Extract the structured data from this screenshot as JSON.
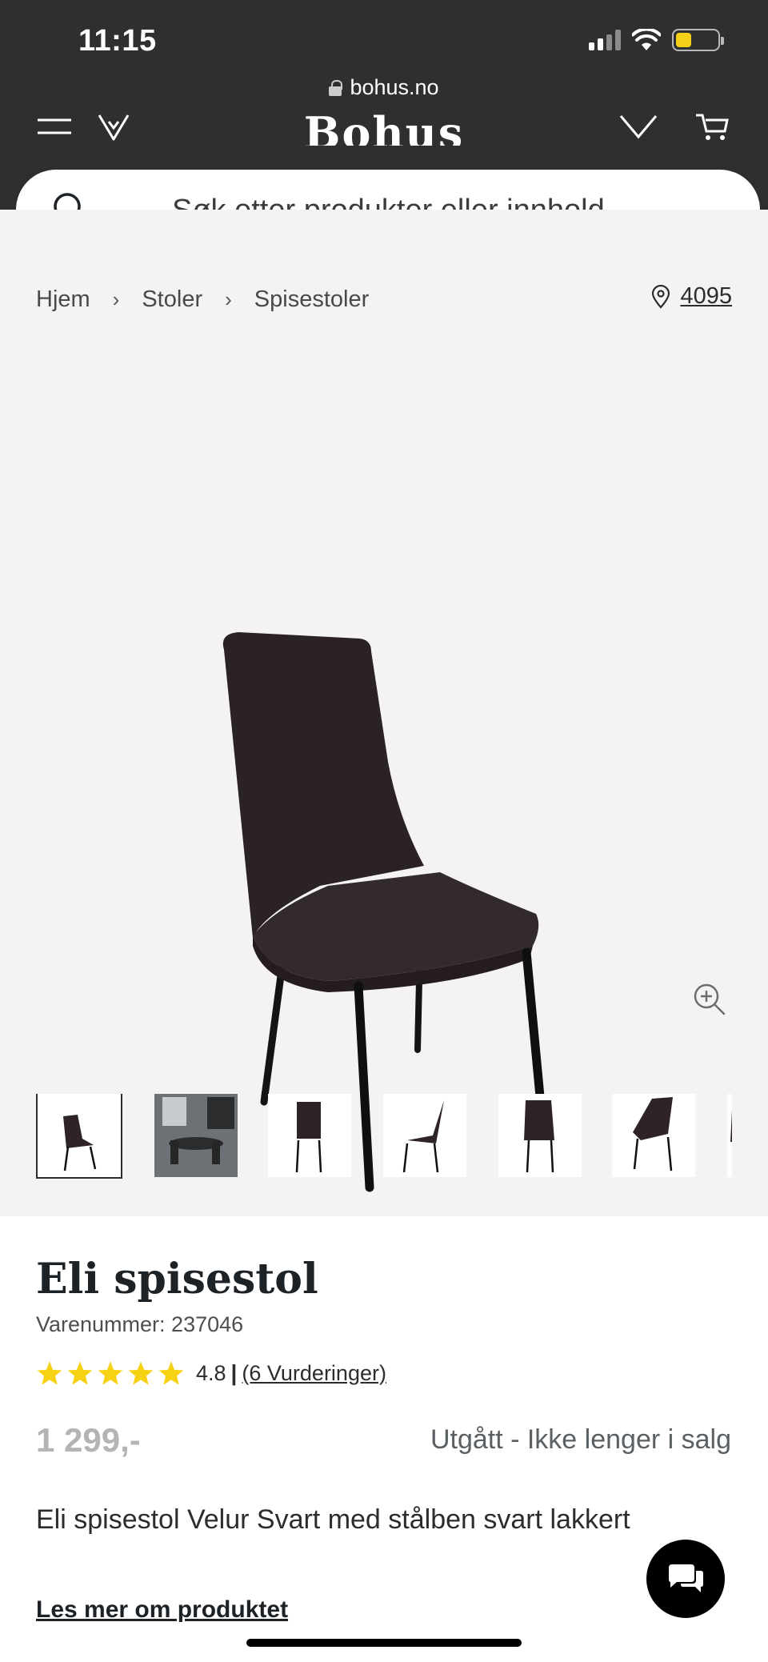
{
  "status_bar": {
    "time": "11:15"
  },
  "browser": {
    "url": "bohus.no"
  },
  "header": {
    "brand": "Bohus"
  },
  "search": {
    "placeholder": "Søk etter produkter eller innhold..."
  },
  "breadcrumb": {
    "items": [
      "Hjem",
      "Stoler",
      "Spisestoler"
    ]
  },
  "store_location": {
    "postal_code": "4095"
  },
  "gallery": {
    "thumbnail_count": 7,
    "active_index": 0
  },
  "product": {
    "title": "Eli spisestol",
    "sku": "Varenummer: 237046",
    "rating_value": "4.8",
    "rating_separator": "|",
    "rating_link": "(6 Vurderinger)",
    "stars": 5,
    "price": "1 299,-",
    "availability": "Utgått - Ikke lenger i salg",
    "description": "Eli spisestol Velur Svart med stålben svart lakkert",
    "read_more": "Les mer om produktet"
  },
  "colors": {
    "header_bg": "#2e2f31",
    "media_bg": "#f5f3f2",
    "star": "#f7d212",
    "battery": "#f5cf18"
  }
}
